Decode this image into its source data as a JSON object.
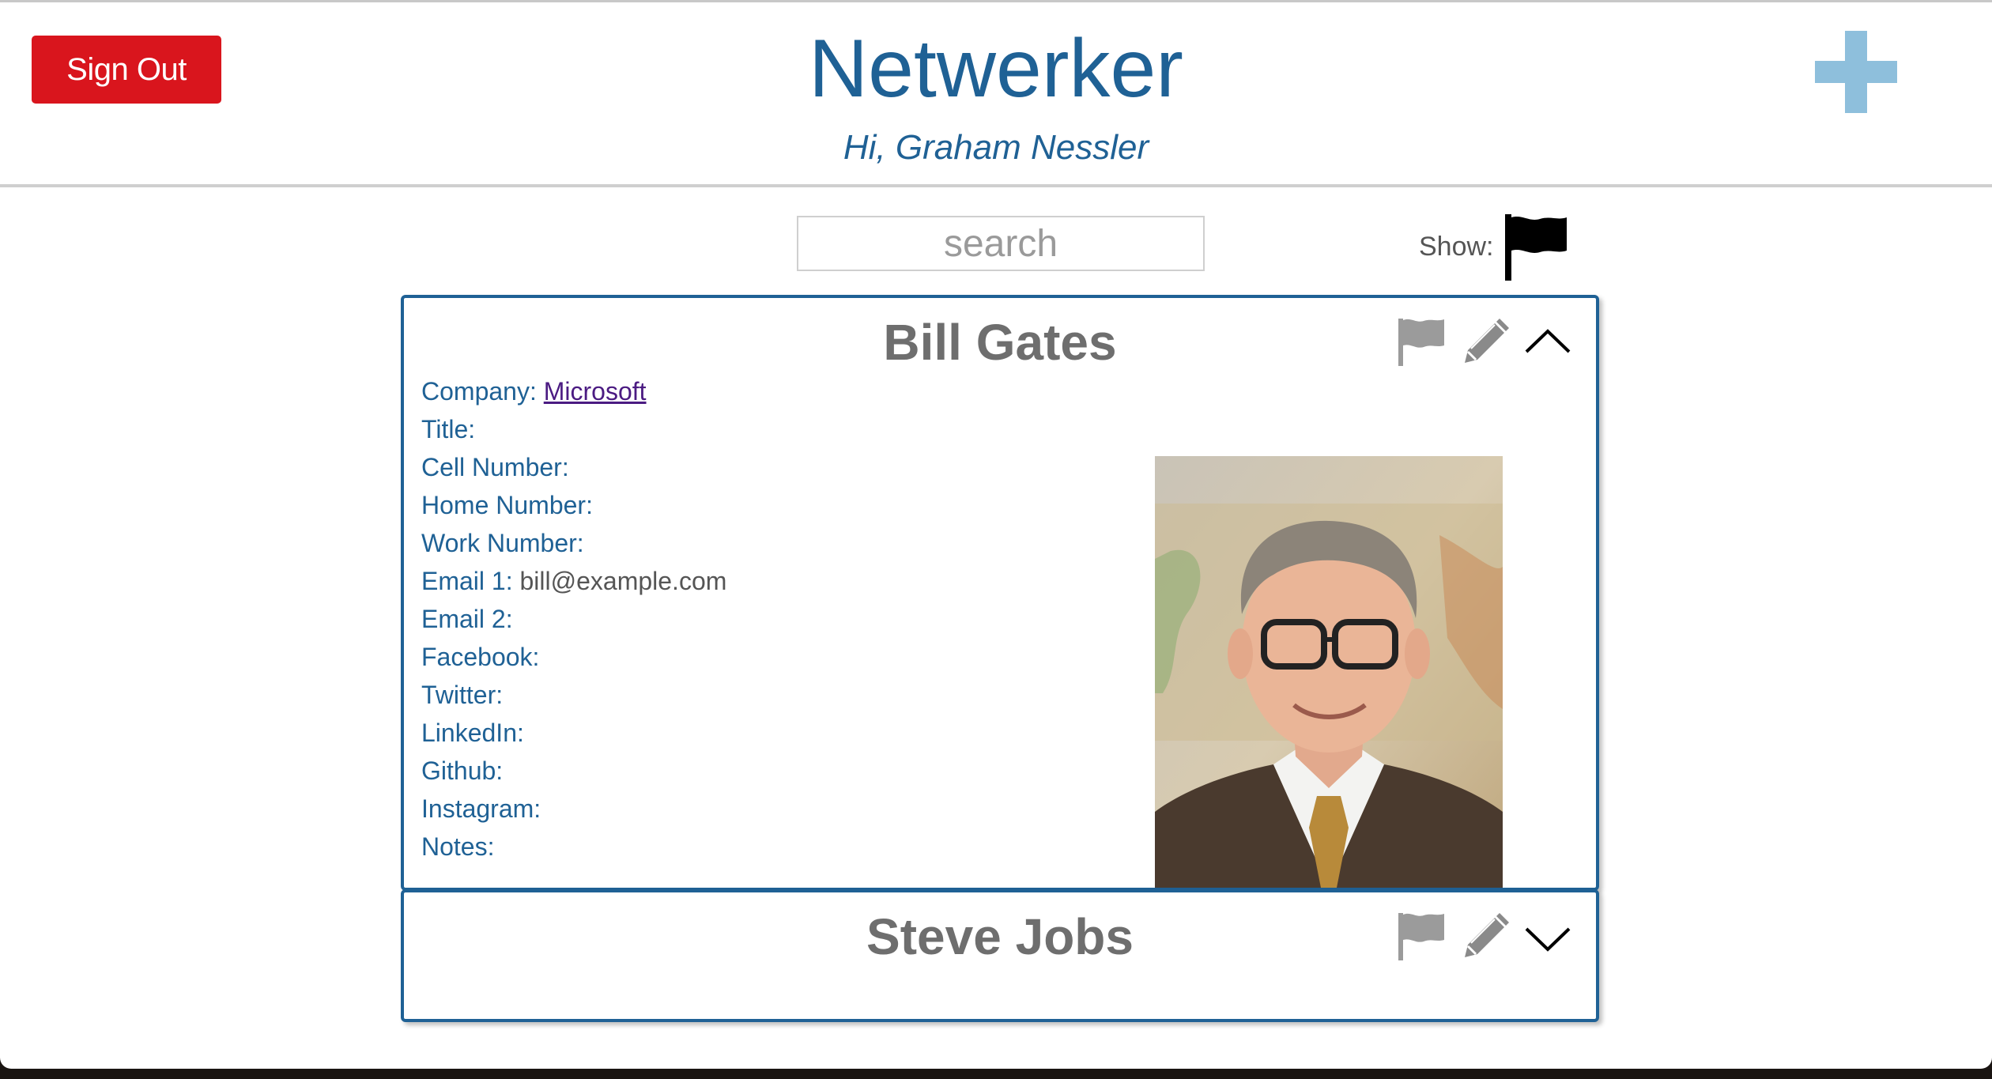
{
  "header": {
    "sign_out_label": "Sign Out",
    "app_title": "Netwerker",
    "greeting": "Hi, Graham Nessler",
    "add_icon": "plus-icon"
  },
  "toolbar": {
    "search_placeholder": "search",
    "search_value": "",
    "show_label": "Show:",
    "show_filter_icon": "flag-icon"
  },
  "colors": {
    "brand_blue": "#1f6195",
    "sign_out_red": "#d9151d",
    "add_light_blue": "#8ebfdc",
    "name_gray": "#6e6e6e",
    "link_purple": "#4b1b82"
  },
  "contacts": [
    {
      "name": "Bill Gates",
      "expanded": true,
      "icons": [
        "flag-outline-icon",
        "pencil-icon",
        "chevron-up-icon"
      ],
      "fields": [
        {
          "label": "Company:",
          "value": "Microsoft",
          "is_link": true
        },
        {
          "label": "Title:",
          "value": ""
        },
        {
          "label": "Cell Number:",
          "value": ""
        },
        {
          "label": "Home Number:",
          "value": ""
        },
        {
          "label": "Work Number:",
          "value": ""
        },
        {
          "label": "Email 1:",
          "value": "bill@example.com"
        },
        {
          "label": "Email 2:",
          "value": ""
        },
        {
          "label": "Facebook:",
          "value": ""
        },
        {
          "label": "Twitter:",
          "value": ""
        },
        {
          "label": "LinkedIn:",
          "value": ""
        },
        {
          "label": "Github:",
          "value": ""
        },
        {
          "label": "Instagram:",
          "value": ""
        },
        {
          "label": "Notes:",
          "value": ""
        }
      ],
      "photo": "portrait-photo"
    },
    {
      "name": "Steve Jobs",
      "expanded": false,
      "icons": [
        "flag-outline-icon",
        "pencil-icon",
        "chevron-down-icon"
      ]
    }
  ]
}
